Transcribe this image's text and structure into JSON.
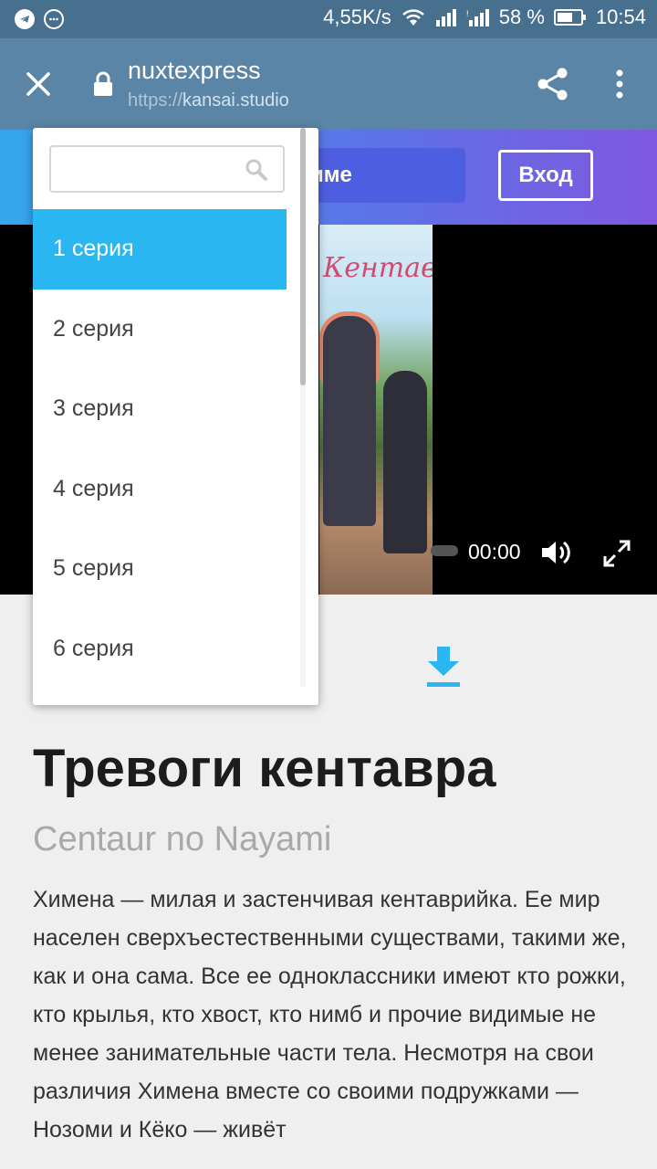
{
  "status_bar": {
    "speed": "4,55K/s",
    "battery": "58 %",
    "time": "10:54"
  },
  "browser": {
    "site_name": "nuxtexpress",
    "url_protocol": "https://",
    "url_domain": "kansai.studio"
  },
  "header": {
    "nav_tab": "име",
    "login": "Вход"
  },
  "player": {
    "poster_title": "Кентавр",
    "time": "00:00"
  },
  "dropdown": {
    "search_value": "",
    "selected_index": 0,
    "items": [
      "1 серия",
      "2 серия",
      "3 серия",
      "4 серия",
      "5 серия",
      "6 серия"
    ]
  },
  "content": {
    "title": "Тревоги кентавра",
    "subtitle": "Centaur no Nayami",
    "description": "Химена — милая и застенчивая кентаврийка. Ее мир населен сверхъестественными существами, такими же, как и она сама. Все ее одноклассники имеют кто рожки, кто крылья, кто хвост, кто нимб и прочие видимые не менее занимательные части тела. Несмотря на свои различия Химена вместе со своими подружками — Нозоми и Кёко — живёт"
  },
  "colors": {
    "status_bar": "#476f8e",
    "toolbar": "#5b85a6",
    "accent": "#29b6f1",
    "header_gradient_start": "#35a6ec",
    "header_gradient_end": "#7f58df"
  }
}
